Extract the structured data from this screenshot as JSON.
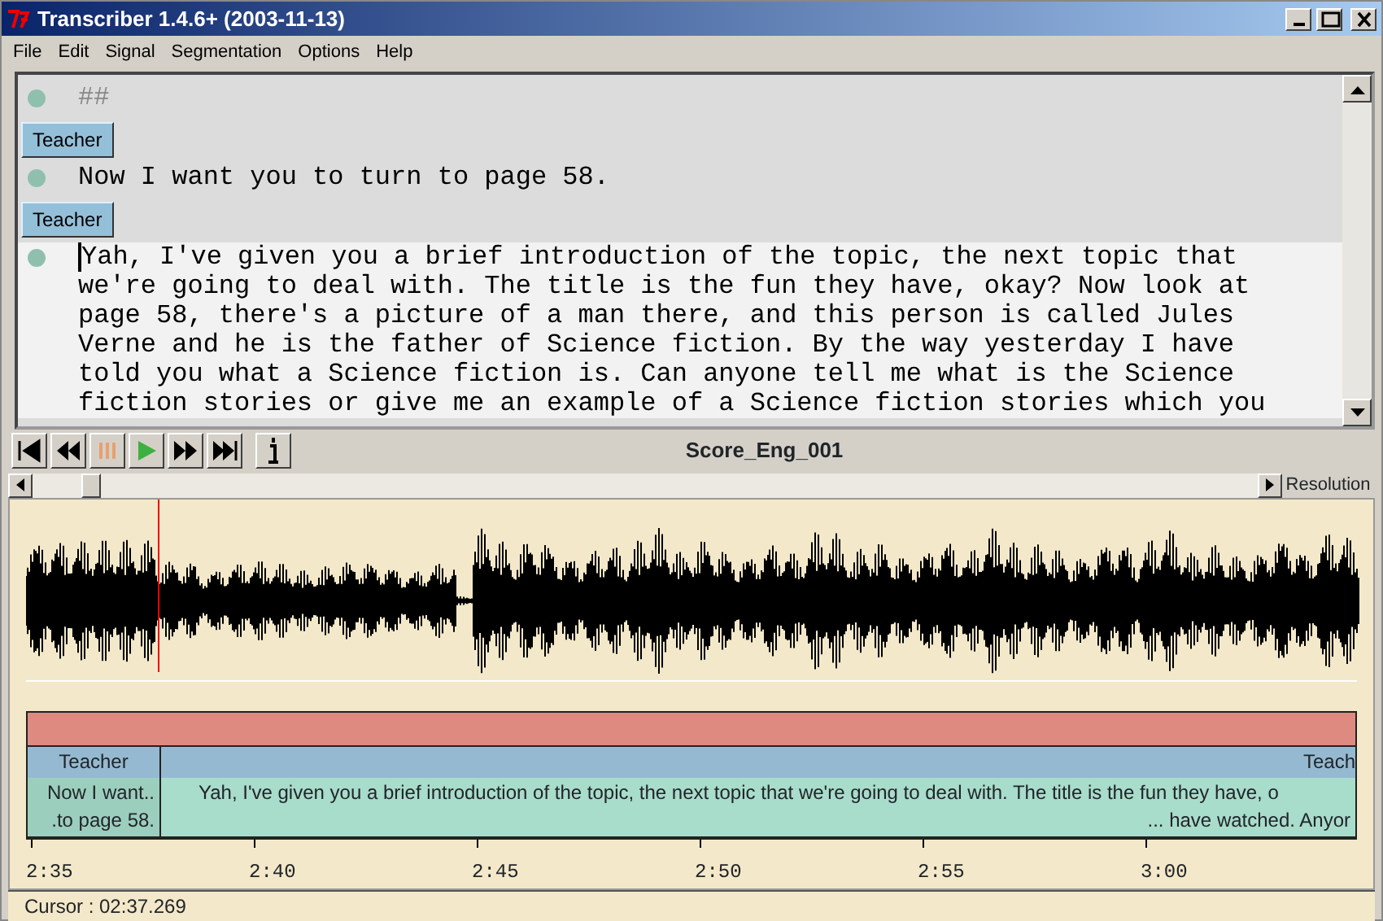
{
  "window": {
    "title": "Transcriber 1.4.6+ (2003-11-13)"
  },
  "menu": [
    "File",
    "Edit",
    "Signal",
    "Segmentation",
    "Options",
    "Help"
  ],
  "editor": [
    {
      "kind": "segment",
      "selected": false,
      "muted": true,
      "lines": [
        "##"
      ]
    },
    {
      "kind": "speaker",
      "label": "Teacher"
    },
    {
      "kind": "segment",
      "selected": false,
      "muted": false,
      "lines": [
        "Now I want you to turn to page 58."
      ]
    },
    {
      "kind": "speaker",
      "label": "Teacher"
    },
    {
      "kind": "segment",
      "selected": true,
      "muted": false,
      "lines": [
        "Yah, I've given you a brief introduction of the topic, the next topic that",
        "we're going to deal with. The title is the fun they have, okay? Now look at",
        "page 58, there's a picture of a man there, and this person is called Jules",
        "Verne and he is the father of Science fiction. By the way yesterday I have",
        "told you what a Science fiction is. Can anyone tell me what is the Science",
        "fiction stories or give me an example of a Science fiction stories which you"
      ]
    }
  ],
  "player": {
    "file": "Score_Eng_001",
    "resolution_label": "Resolution"
  },
  "speaker_track": [
    {
      "label": "Teacher",
      "selected": false
    },
    {
      "label": "Teach",
      "selected": true
    }
  ],
  "segment_track": [
    {
      "lines": [
        "Now I want..",
        ".to page 58."
      ],
      "selected": false
    },
    {
      "lines": [
        "Yah, I've given you a brief introduction of the topic, the next topic that we're going to deal with. The title is the fun they have, o",
        "... have watched. Anyor"
      ],
      "selected": true
    }
  ],
  "time_axis": [
    "2:35",
    "2:40",
    "2:45",
    "2:50",
    "2:55",
    "3:00"
  ],
  "status_bar": {
    "cursor": "Cursor : 02:37.269"
  }
}
